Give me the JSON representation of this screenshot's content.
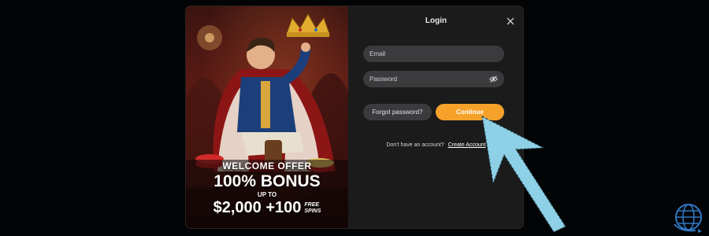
{
  "promo": {
    "offer": "WELCOME OFFER",
    "bonus": "100% BONUS",
    "up_to": "UP TO",
    "amount": "$2,000 +100",
    "free": "FREE",
    "spins": "SPINS"
  },
  "login": {
    "title": "Login",
    "email_placeholder": "Email",
    "password_placeholder": "Password",
    "forgot_label": "Forgot password?",
    "continue_label": "Continue",
    "no_account_text": "Don't have an account?",
    "create_account_label": "Create Account"
  },
  "icons": {
    "close": "close-icon",
    "eye_off": "eye-off-icon",
    "arrow": "arrow-pointer",
    "globe": "globe-icon",
    "crown": "crown-icon"
  },
  "colors": {
    "accent": "#f6a22a",
    "panel": "#1b1b1c",
    "field": "#3b3b3e",
    "arrow": "#8ed0e6",
    "globe": "#2f78c4"
  }
}
